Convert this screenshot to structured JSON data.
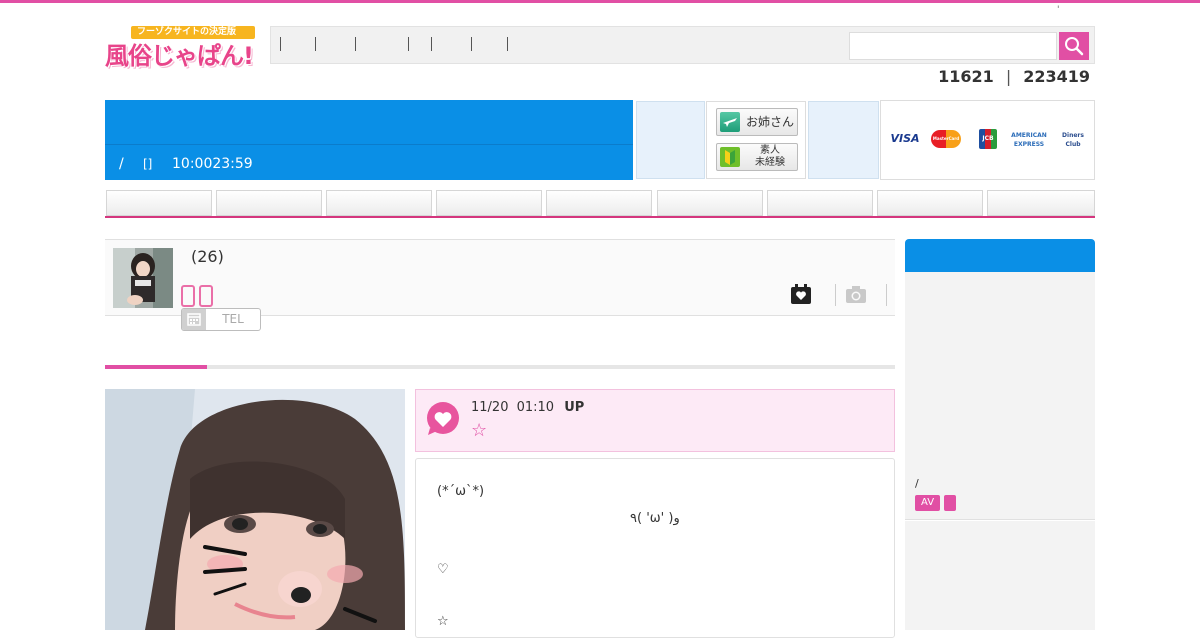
{
  "header": {
    "logo_tagline": "フーゾクサイトの決定版",
    "logo_title": "風俗じゃぱん!",
    "tiny_mark": "'",
    "nav_separator": "|",
    "search_placeholder": ""
  },
  "stats": {
    "count_a": "11621",
    "separator": "|",
    "count_b": "223419"
  },
  "banner": {
    "slash": "/",
    "brackets": "[]",
    "hours": "10:0023:59"
  },
  "promo_buttons": {
    "onesan_label": "お姉さん",
    "shirouto_label_line1": "素人",
    "shirouto_label_line2": "未経験"
  },
  "cards": [
    "VISA",
    "MasterCard",
    "JCB",
    "AMERICAN EXPRESS",
    "Diners Club"
  ],
  "profile": {
    "age": "(26)",
    "tel_label": "TEL"
  },
  "post": {
    "date": "11/20",
    "time": "01:10",
    "up_label": "UP",
    "title_star": "☆",
    "lines": [
      "(*´ω`*)",
      "٩( 'ω' )و",
      "♡",
      "☆"
    ]
  },
  "sidebar": {
    "slash": "/",
    "badge_av": "AV"
  },
  "colors": {
    "accent_pink": "#e14fa4",
    "banner_blue": "#0a8fe6"
  }
}
